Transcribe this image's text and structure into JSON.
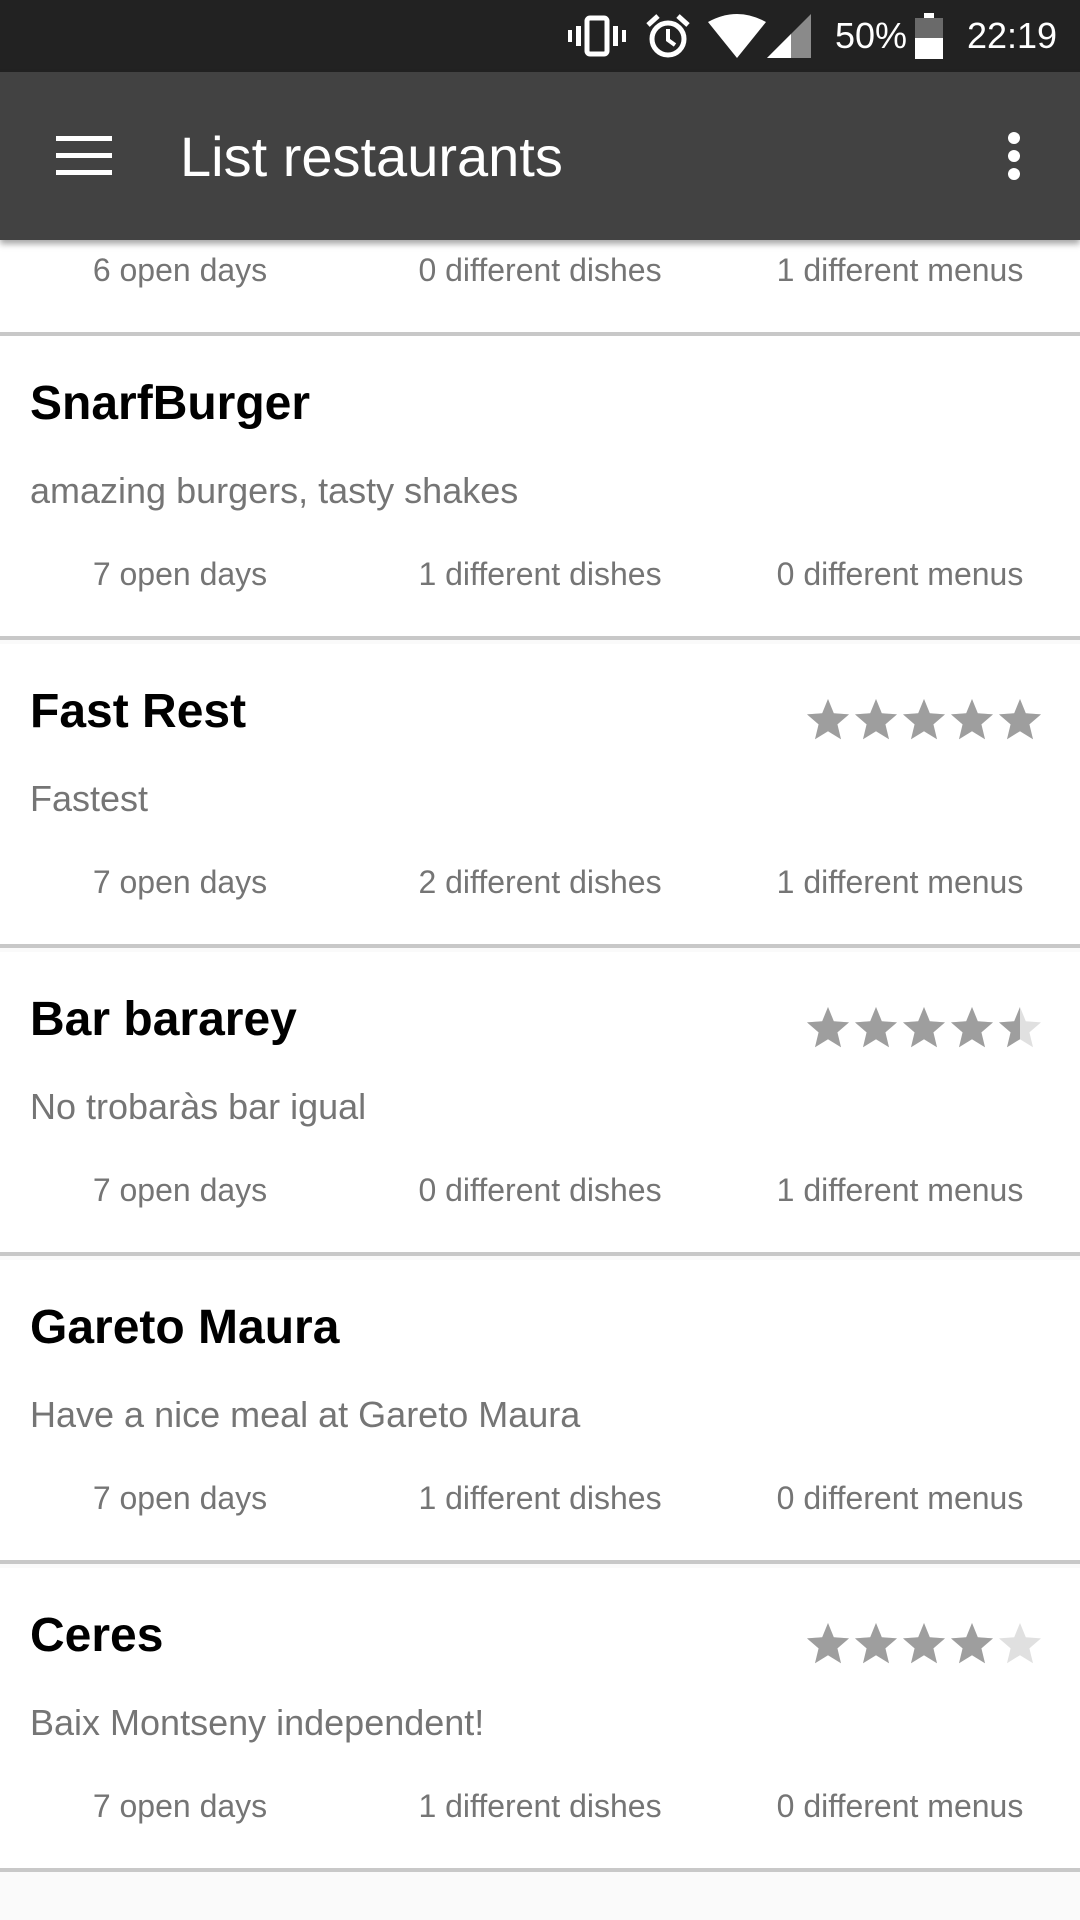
{
  "status_bar": {
    "battery": "50%",
    "time": "22:19",
    "icons": [
      "vibrate-icon",
      "alarm-icon",
      "wifi-icon",
      "signal-icon",
      "battery-icon"
    ]
  },
  "app_bar": {
    "title": "List restaurants",
    "menu_icon": "hamburger-menu-icon",
    "overflow_icon": "more-vert-icon",
    "background": "#424242"
  },
  "colors": {
    "star_filled": "#9e9e9e",
    "star_empty": "#e0e0e0",
    "divider": "#c8c8c8"
  },
  "restaurants": [
    {
      "name": "",
      "description": "",
      "open_days": "6 open days",
      "dishes": "0 different dishes",
      "menus": "1 different menus",
      "rating": null
    },
    {
      "name": "SnarfBurger",
      "description": "amazing burgers, tasty shakes",
      "open_days": "7 open days",
      "dishes": "1 different dishes",
      "menus": "0 different menus",
      "rating": null
    },
    {
      "name": "Fast Rest",
      "description": "Fastest",
      "open_days": "7 open days",
      "dishes": "2 different dishes",
      "menus": "1 different menus",
      "rating": 5
    },
    {
      "name": "Bar bararey",
      "description": "No trobaràs bar igual",
      "open_days": "7 open days",
      "dishes": "0 different dishes",
      "menus": "1 different menus",
      "rating": 4.5
    },
    {
      "name": "Gareto Maura",
      "description": "Have a nice meal at Gareto Maura",
      "open_days": "7 open days",
      "dishes": "1 different dishes",
      "menus": "0 different menus",
      "rating": null
    },
    {
      "name": "Ceres",
      "description": "Baix Montseny independent!",
      "open_days": "7 open days",
      "dishes": "1 different dishes",
      "menus": "0 different menus",
      "rating": 4
    }
  ]
}
